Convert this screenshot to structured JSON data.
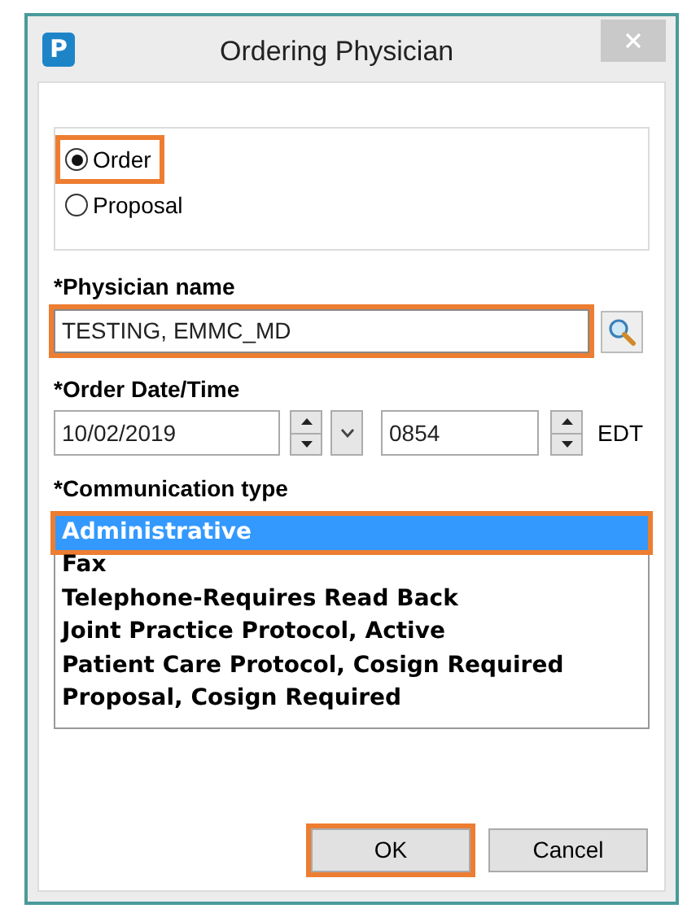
{
  "window": {
    "title": "Ordering Physician",
    "app_icon": "P"
  },
  "order_type": [
    {
      "label": "Order",
      "selected": true,
      "highlighted": true
    },
    {
      "label": "Proposal",
      "selected": false,
      "highlighted": false
    }
  ],
  "physician": {
    "label": "*Physician name",
    "value": "TESTING, EMMC_MD",
    "highlighted": true
  },
  "order_datetime": {
    "label": "*Order Date/Time",
    "date": "10/02/2019",
    "time": "0854",
    "timezone": "EDT"
  },
  "communication": {
    "label": "*Communication type",
    "items": [
      {
        "label": "Administrative",
        "selected": true,
        "highlighted": true
      },
      {
        "label": "Fax",
        "selected": false,
        "highlighted": false
      },
      {
        "label": "Telephone-Requires Read Back",
        "selected": false,
        "highlighted": false
      },
      {
        "label": "Joint Practice Protocol, Active",
        "selected": false,
        "highlighted": false
      },
      {
        "label": "Patient Care Protocol, Cosign Required",
        "selected": false,
        "highlighted": false
      },
      {
        "label": "Proposal, Cosign Required",
        "selected": false,
        "highlighted": false
      }
    ]
  },
  "buttons": [
    {
      "label": "OK",
      "highlighted": true
    },
    {
      "label": "Cancel",
      "highlighted": false
    }
  ]
}
